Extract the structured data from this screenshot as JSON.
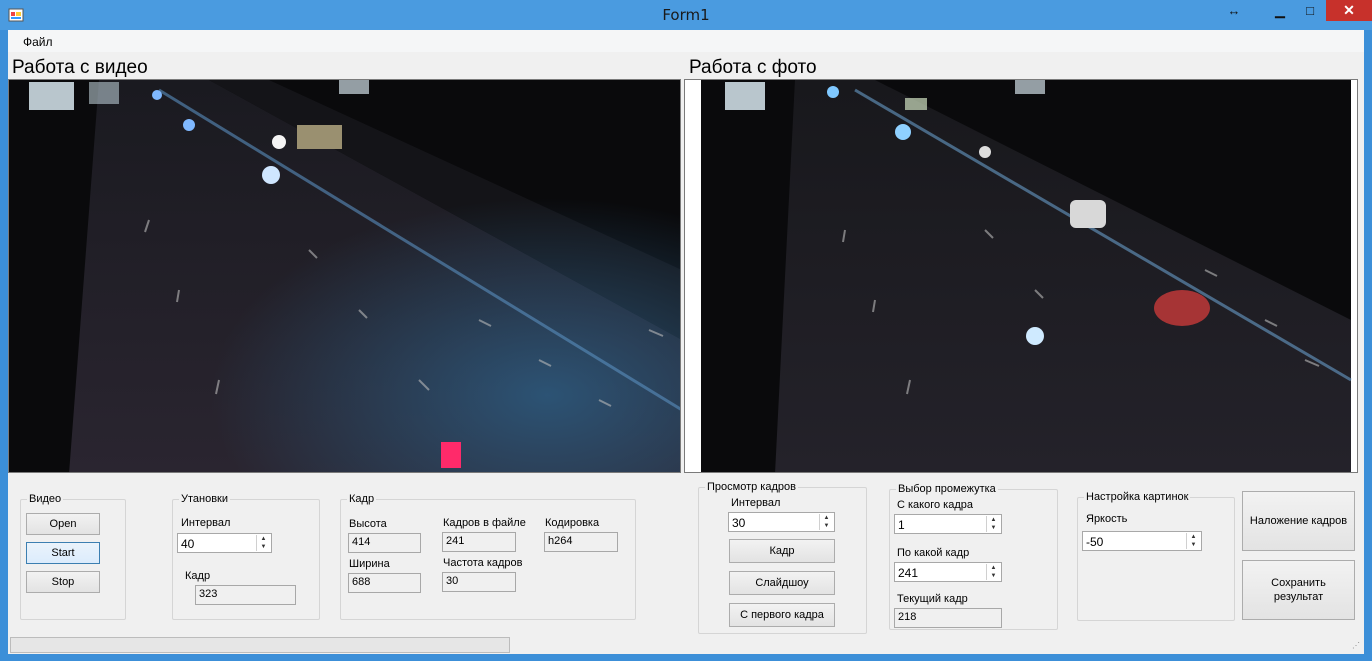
{
  "window": {
    "title": "Form1",
    "min_label": "▁",
    "max_label": "□",
    "close_label": "✕",
    "move_label": "↔"
  },
  "menu": {
    "file": "Файл"
  },
  "video_panel": {
    "title": "Работа с видео"
  },
  "photo_panel": {
    "title": "Работа с фото"
  },
  "video_group": {
    "legend": "Видео",
    "open": "Open",
    "start": "Start",
    "stop": "Stop"
  },
  "settings_group": {
    "legend": "Утановки",
    "interval_label": "Интервал",
    "interval_value": "40",
    "frame_label": "Кадр",
    "frame_value": "323"
  },
  "frame_group": {
    "legend": "Кадр",
    "height_label": "Высота",
    "height_value": "414",
    "width_label": "Ширина",
    "width_value": "688",
    "frames_label": "Кадров в файле",
    "frames_value": "241",
    "fps_label": "Частота кадров",
    "fps_value": "30",
    "codec_label": "Кодировка",
    "codec_value": "h264"
  },
  "view_group": {
    "legend": "Просмотр кадров",
    "interval_label": "Интервал",
    "interval_value": "30",
    "frame_btn": "Кадр",
    "slideshow_btn": "Слайдшоу",
    "first_btn": "С первого кадра"
  },
  "range_group": {
    "legend": "Выбор промежутка",
    "from_label": "С какого кадра",
    "from_value": "1",
    "to_label": "По какой кадр",
    "to_value": "241",
    "current_label": "Текущий кадр",
    "current_value": "218"
  },
  "image_group": {
    "legend": "Настройка картинок",
    "brightness_label": "Яркость",
    "brightness_value": "-50"
  },
  "actions": {
    "overlay": "Наложение кадров",
    "save": "Сохранить результат"
  },
  "progress": {
    "value": 0
  }
}
